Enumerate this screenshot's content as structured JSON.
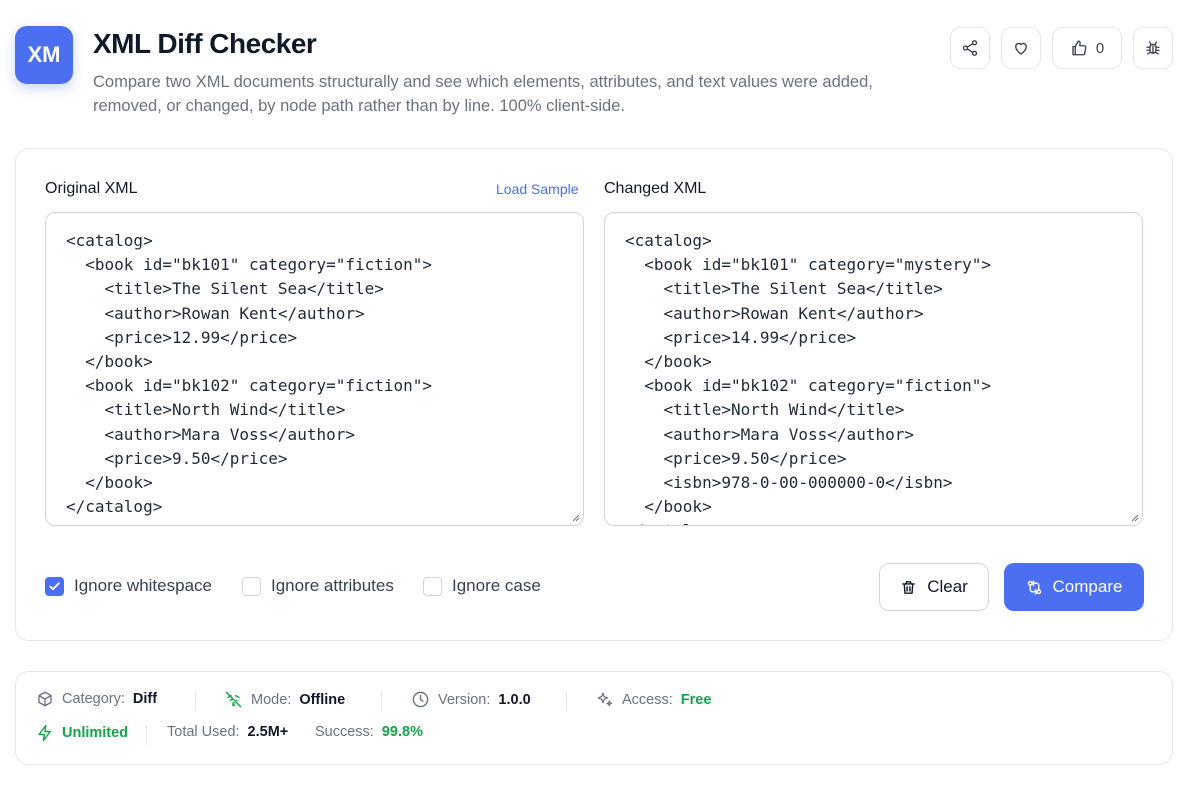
{
  "header": {
    "logo_text": "XM",
    "title": "XML Diff Checker",
    "description": "Compare two XML documents structurally and see which elements, attributes, and text values were added, removed, or changed, by node path rather than by line. 100% client-side.",
    "like_count": "0",
    "icons": [
      "share-icon",
      "heart-icon",
      "thumbs-up-icon",
      "bug-icon"
    ]
  },
  "original": {
    "label": "Original XML",
    "load_sample": "Load Sample",
    "content": "<catalog>\n  <book id=\"bk101\" category=\"fiction\">\n    <title>The Silent Sea</title>\n    <author>Rowan Kent</author>\n    <price>12.99</price>\n  </book>\n  <book id=\"bk102\" category=\"fiction\">\n    <title>North Wind</title>\n    <author>Mara Voss</author>\n    <price>9.50</price>\n  </book>\n</catalog>"
  },
  "changed": {
    "label": "Changed XML",
    "content": "<catalog>\n  <book id=\"bk101\" category=\"mystery\">\n    <title>The Silent Sea</title>\n    <author>Rowan Kent</author>\n    <price>14.99</price>\n  </book>\n  <book id=\"bk102\" category=\"fiction\">\n    <title>North Wind</title>\n    <author>Mara Voss</author>\n    <price>9.50</price>\n    <isbn>978-0-00-000000-0</isbn>\n  </book>\n</catalog>"
  },
  "options": {
    "ignore_whitespace": {
      "label": "Ignore whitespace",
      "checked": true
    },
    "ignore_attributes": {
      "label": "Ignore attributes",
      "checked": false
    },
    "ignore_case": {
      "label": "Ignore case",
      "checked": false
    }
  },
  "actions": {
    "clear_label": "Clear",
    "compare_label": "Compare"
  },
  "stats": {
    "category_label": "Category:",
    "category_value": "Diff",
    "mode_label": "Mode:",
    "mode_value": "Offline",
    "version_label": "Version:",
    "version_value": "1.0.0",
    "access_label": "Access:",
    "access_value": "Free",
    "unlimited": "Unlimited",
    "total_label": "Total Used:",
    "total_value": "2.5M+",
    "success_label": "Success:",
    "success_value": "99.8%"
  },
  "colors": {
    "accent": "#4b6ff0",
    "success": "#16a34a"
  }
}
